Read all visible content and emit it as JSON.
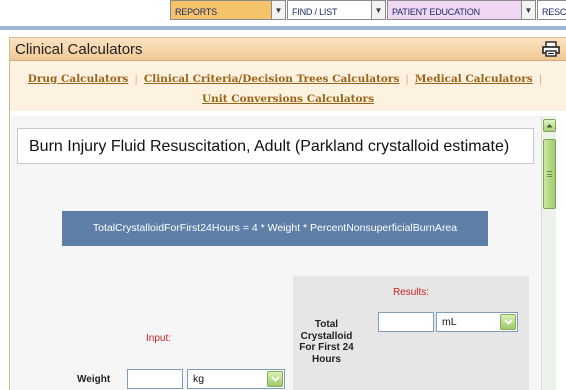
{
  "nav": {
    "reports": "REPORTS",
    "find_list": "FIND / LIST",
    "patient_education": "PATIENT EDUCATION",
    "resc": "RESC",
    "colors": {
      "reports_bg": "#f5c36a",
      "find_bg": "#ffffff",
      "patient_bg": "#f0d8f2",
      "resc_bg": "#ffffff"
    }
  },
  "panel": {
    "title": "Clinical Calculators",
    "print_icon": "printer-icon"
  },
  "links": {
    "drug": "Drug Calculators",
    "criteria": "Clinical Criteria/Decision Trees Calculators",
    "medical": "Medical Calculators",
    "conversions": "Unit Conversions Calculators",
    "separator": "|"
  },
  "calculator": {
    "title": "Burn Injury Fluid Resuscitation, Adult (Parkland crystalloid estimate)",
    "formula": "TotalCrystalloidForFirst24Hours = 4 * Weight * PercentNonsuperficialBurnArea",
    "results_label": "Results:",
    "input_label": "Input:",
    "total_label": "Total Crystalloid For First 24 Hours",
    "total_value": "",
    "total_unit": "mL",
    "weight_label": "Weight",
    "weight_value": "",
    "weight_unit": "kg"
  },
  "scrollbar": {
    "up_icon": "scroll-up-arrow-icon",
    "position": 0.0
  }
}
